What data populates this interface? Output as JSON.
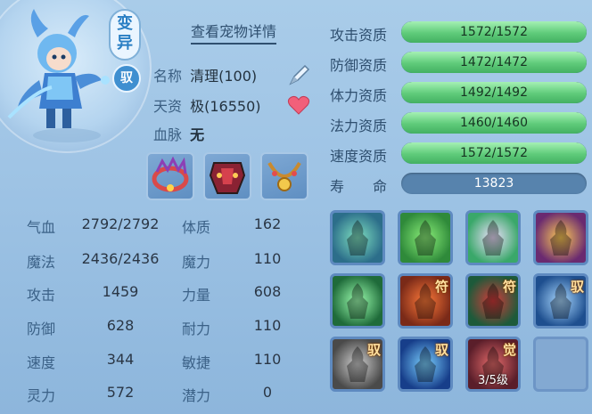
{
  "pet": {
    "variant_tag": [
      "变",
      "异"
    ],
    "yu_badge": "驭",
    "detail_link": "查看宠物详情",
    "name_label": "名称",
    "name_value": "清理(100)",
    "talent_label": "天资",
    "talent_value": "极(16550)",
    "bloodline_label": "血脉",
    "bloodline_value": "无"
  },
  "equipment": [
    {
      "name": "equip-crown"
    },
    {
      "name": "equip-armor"
    },
    {
      "name": "equip-necklace"
    }
  ],
  "stats_left": [
    {
      "label": "气血",
      "value": "2792/2792"
    },
    {
      "label": "魔法",
      "value": "2436/2436"
    },
    {
      "label": "攻击",
      "value": "1459"
    },
    {
      "label": "防御",
      "value": "628"
    },
    {
      "label": "速度",
      "value": "344"
    },
    {
      "label": "灵力",
      "value": "572"
    }
  ],
  "stats_right": [
    {
      "label": "体质",
      "value": "162"
    },
    {
      "label": "魔力",
      "value": "110"
    },
    {
      "label": "力量",
      "value": "608"
    },
    {
      "label": "耐力",
      "value": "110"
    },
    {
      "label": "敏捷",
      "value": "110"
    },
    {
      "label": "潜力",
      "value": "0"
    }
  ],
  "aptitudes": [
    {
      "label": "攻击资质",
      "value": "1572/1572",
      "fill": 1.0
    },
    {
      "label": "防御资质",
      "value": "1472/1472",
      "fill": 1.0
    },
    {
      "label": "体力资质",
      "value": "1492/1492",
      "fill": 1.0
    },
    {
      "label": "法力资质",
      "value": "1460/1460",
      "fill": 1.0
    },
    {
      "label": "速度资质",
      "value": "1572/1572",
      "fill": 1.0
    }
  ],
  "lifespan": {
    "label": "寿　　命",
    "value": "13823"
  },
  "skills": [
    {
      "name": "skill-figure-wave",
      "corner": "",
      "level": ""
    },
    {
      "name": "skill-green-muscle",
      "corner": "",
      "level": ""
    },
    {
      "name": "skill-heart-light",
      "corner": "",
      "level": ""
    },
    {
      "name": "skill-red-scroll",
      "corner": "",
      "level": ""
    },
    {
      "name": "skill-green-blades",
      "corner": "",
      "level": ""
    },
    {
      "name": "skill-red-muscle",
      "corner": "符",
      "level": ""
    },
    {
      "name": "skill-blood-drop",
      "corner": "符",
      "level": ""
    },
    {
      "name": "skill-shield",
      "corner": "驭",
      "level": ""
    },
    {
      "name": "skill-stone-beast",
      "corner": "驭",
      "level": ""
    },
    {
      "name": "skill-blue-vortex",
      "corner": "驭",
      "level": ""
    },
    {
      "name": "skill-awaken-fist",
      "corner": "觉",
      "level": "3/5级"
    },
    {
      "name": "skill-empty-slot",
      "corner": "",
      "level": ""
    }
  ],
  "colors": {
    "panel_bg": "#9fc4e5",
    "bar_fill": "#5fcb7a",
    "bar_track": "#3d6f99",
    "label_text": "#3b6187"
  }
}
